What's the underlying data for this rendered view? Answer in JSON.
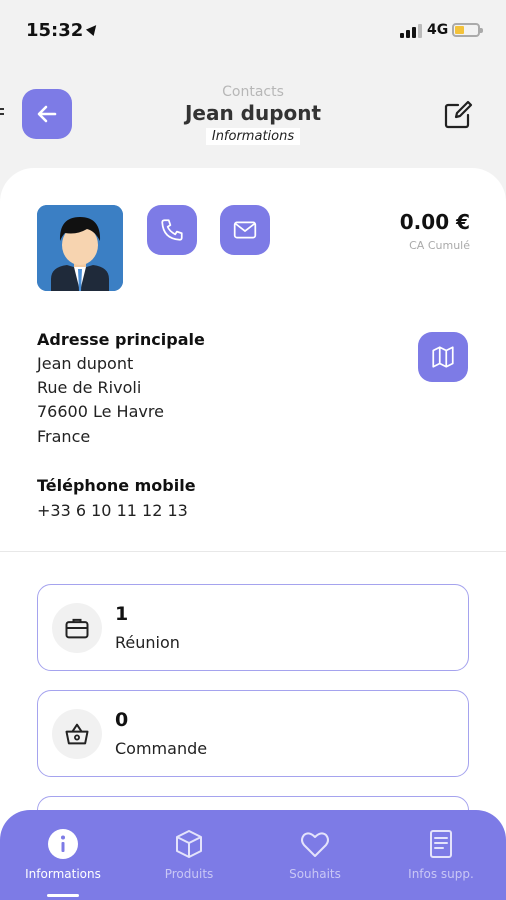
{
  "status_bar": {
    "time": "15:32",
    "network": "4G",
    "battery_level": 0.4,
    "battery_color": "#f3c23a"
  },
  "header": {
    "overline": "Contacts",
    "title": "Jean dupont",
    "subtitle": "Informations",
    "back_icon": "arrow-left-icon",
    "edit_icon": "edit-icon"
  },
  "contact": {
    "ca_amount": "0.00 €",
    "ca_label": "CA Cumulé",
    "address_title": "Adresse principale",
    "address_lines": [
      "Jean dupont",
      "Rue de Rivoli",
      "76600 Le Havre",
      "France"
    ],
    "phone_title": "Téléphone mobile",
    "phone_value": "+33 6 10 11 12 13"
  },
  "stats": [
    {
      "value": "1",
      "label": "Réunion",
      "icon": "briefcase-icon"
    },
    {
      "value": "0",
      "label": "Commande",
      "icon": "basket-icon"
    }
  ],
  "tabs": [
    {
      "label": "Informations",
      "icon": "info-icon",
      "active": true
    },
    {
      "label": "Produits",
      "icon": "box-icon",
      "active": false
    },
    {
      "label": "Souhaits",
      "icon": "heart-icon",
      "active": false
    },
    {
      "label": "Infos supp.",
      "icon": "document-icon",
      "active": false
    }
  ],
  "colors": {
    "accent": "#7d7be6",
    "card_border": "#a5a3ee"
  }
}
